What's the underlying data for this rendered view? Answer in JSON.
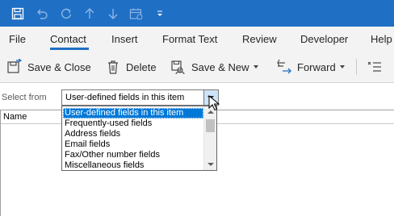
{
  "quick_access": {
    "items": [
      "save-icon",
      "undo-icon",
      "redo-icon",
      "up-icon",
      "down-icon",
      "calendar-icon",
      "customize-qat-icon"
    ]
  },
  "ribbon": {
    "tabs": [
      {
        "label": "File"
      },
      {
        "label": "Contact"
      },
      {
        "label": "Insert"
      },
      {
        "label": "Format Text"
      },
      {
        "label": "Review"
      },
      {
        "label": "Developer"
      },
      {
        "label": "Help"
      }
    ],
    "active_tab": "Contact",
    "commands": [
      {
        "label": "Save & Close",
        "icon": "save-close-icon"
      },
      {
        "label": "Delete",
        "icon": "trash-icon"
      },
      {
        "label": "Save & New",
        "icon": "save-new-icon"
      },
      {
        "label": "Forward",
        "icon": "forward-icon"
      }
    ]
  },
  "form": {
    "select_from_label": "Select from",
    "select_value": "User-defined fields in this item",
    "dropdown_options": [
      "User-defined fields in this item",
      "Frequently-used fields",
      "Address fields",
      "Email fields",
      "Fax/Other number fields",
      "Miscellaneous fields"
    ],
    "field_list_header": "Name"
  },
  "colors": {
    "titlebar": "#1f6fc5",
    "ribbon_bg": "#f3f3f3",
    "accent": "#1f6fc5",
    "selection": "#0078d7"
  }
}
